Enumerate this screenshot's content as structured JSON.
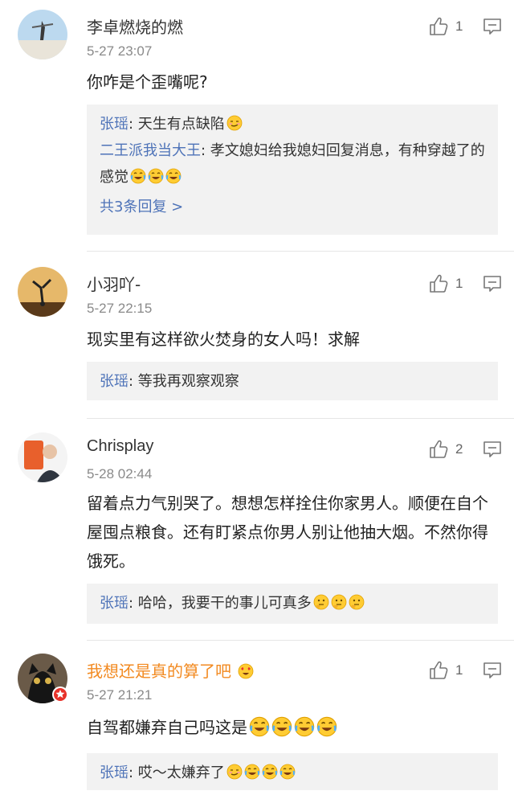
{
  "comments": [
    {
      "name": "李卓燃烧的燃",
      "time": "5-27 23:07",
      "text": "你咋是个歪嘴呢?",
      "likes": "1",
      "replies": [
        {
          "name": "张瑶",
          "text": ": 天生有点缺陷"
        },
        {
          "name": "二王派我当大王",
          "text": ": 孝文媳妇给我媳妇回复消息，有种穿越了的感觉"
        }
      ],
      "more": "共3条回复 >"
    },
    {
      "name": "小羽吖-",
      "time": "5-27 22:15",
      "text": "现实里有这样欲火焚身的女人吗！求解",
      "likes": "1",
      "replies": [
        {
          "name": "张瑶",
          "text": ": 等我再观察观察"
        }
      ]
    },
    {
      "name": "Chrisplay",
      "time": "5-28 02:44",
      "text": "留着点力气别哭了。想想怎样拴住你家男人。顺便在自个屋囤点粮食。还有盯紧点你男人别让他抽大烟。不然你得饿死。",
      "likes": "2",
      "replies": [
        {
          "name": "张瑶",
          "text": ": 哈哈，我要干的事儿可真多"
        }
      ]
    },
    {
      "name": "我想还是真的算了吧",
      "time": "5-27 21:21",
      "text": "自驾都嫌弃自己吗这是",
      "likes": "1",
      "replies": [
        {
          "name": "张瑶",
          "text": ": 哎～太嫌弃了"
        }
      ]
    }
  ],
  "colors": {
    "link": "#4e73b8",
    "orange_name": "#f28a21",
    "reply_bg": "#f2f2f2"
  },
  "icons": [
    "thumbs-up-icon",
    "comment-icon",
    "laugh-cry-emoji",
    "smirk-emoji",
    "thinking-emoji",
    "v-badge-icon"
  ]
}
